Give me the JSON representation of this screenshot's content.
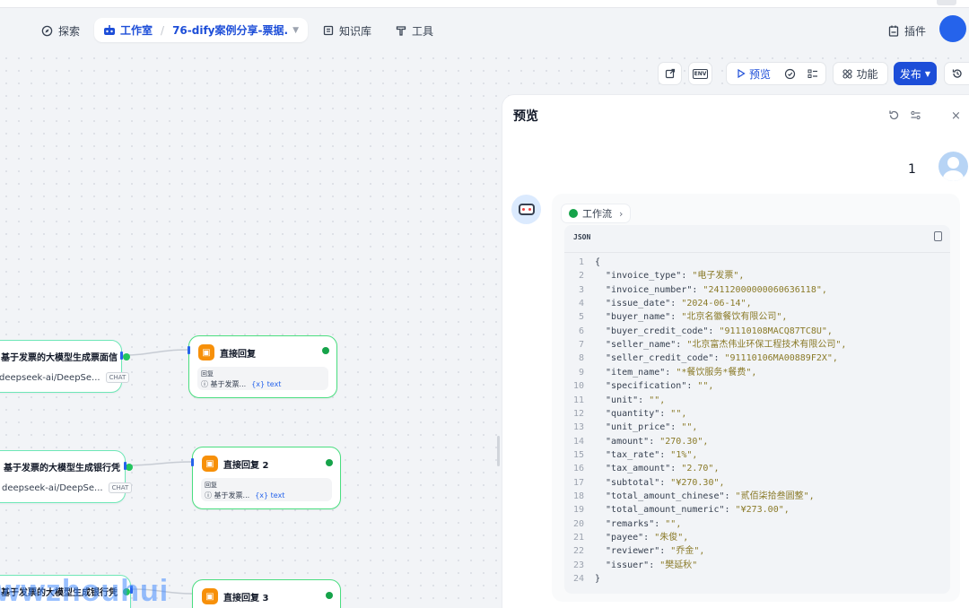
{
  "nav": {
    "explore": "探索",
    "studio": "工作室",
    "app_name": "76-dify案例分享-票据...",
    "knowledge": "知识库",
    "tools": "工具",
    "plugins": "插件"
  },
  "toolbar": {
    "env_label": "ENV",
    "preview": "预览",
    "features": "功能",
    "publish": "发布"
  },
  "nodes": {
    "llm1": {
      "title": "基于发票的大模型生成票面信",
      "model": "deepseek-ai/DeepSe...",
      "tag": "CHAT"
    },
    "llm2": {
      "title": "基于发票的大模型生成银行凭",
      "model": "deepseek-ai/DeepSe...",
      "tag": "CHAT"
    },
    "llm3": {
      "title": "基于发票的大模型生成银行凭"
    },
    "reply1": {
      "title": "直接回复",
      "label": "回复",
      "source": "基于发票...",
      "var": "{x} text"
    },
    "reply2": {
      "title": "直接回复 2",
      "label": "回复",
      "source": "基于发票...",
      "var": "{x} text"
    },
    "reply3": {
      "title": "直接回复 3"
    }
  },
  "preview": {
    "title": "预览",
    "user_message": "1",
    "workflow_chip": "工作流",
    "code_lang": "JSON",
    "code_lines": [
      {
        "n": "1",
        "t": "{"
      },
      {
        "n": "2",
        "k": "\"invoice_type\"",
        "v": "\"电子发票\","
      },
      {
        "n": "3",
        "k": "\"invoice_number\"",
        "v": "\"24112000000060636118\","
      },
      {
        "n": "4",
        "k": "\"issue_date\"",
        "v": "\"2024-06-14\","
      },
      {
        "n": "5",
        "k": "\"buyer_name\"",
        "v": "\"北京名徽餐饮有限公司\","
      },
      {
        "n": "6",
        "k": "\"buyer_credit_code\"",
        "v": "\"91110108MACQ87TC8U\","
      },
      {
        "n": "7",
        "k": "\"seller_name\"",
        "v": "\"北京富杰伟业环保工程技术有限公司\","
      },
      {
        "n": "8",
        "k": "\"seller_credit_code\"",
        "v": "\"91110106MA00889F2X\","
      },
      {
        "n": "9",
        "k": "\"item_name\"",
        "v": "\"*餐饮服务*餐费\","
      },
      {
        "n": "10",
        "k": "\"specification\"",
        "v": "\"\","
      },
      {
        "n": "11",
        "k": "\"unit\"",
        "v": "\"\","
      },
      {
        "n": "12",
        "k": "\"quantity\"",
        "v": "\"\","
      },
      {
        "n": "13",
        "k": "\"unit_price\"",
        "v": "\"\","
      },
      {
        "n": "14",
        "k": "\"amount\"",
        "v": "\"270.30\","
      },
      {
        "n": "15",
        "k": "\"tax_rate\"",
        "v": "\"1%\","
      },
      {
        "n": "16",
        "k": "\"tax_amount\"",
        "v": "\"2.70\","
      },
      {
        "n": "17",
        "k": "\"subtotal\"",
        "v": "\"¥270.30\","
      },
      {
        "n": "18",
        "k": "\"total_amount_chinese\"",
        "v": "\"贰佰柒拾叁圆整\","
      },
      {
        "n": "19",
        "k": "\"total_amount_numeric\"",
        "v": "\"¥273.00\","
      },
      {
        "n": "20",
        "k": "\"remarks\"",
        "v": "\"\","
      },
      {
        "n": "21",
        "k": "\"payee\"",
        "v": "\"朱俊\","
      },
      {
        "n": "22",
        "k": "\"reviewer\"",
        "v": "\"乔金\","
      },
      {
        "n": "23",
        "k": "\"issuer\"",
        "v": "\"樊延秋\""
      },
      {
        "n": "24",
        "t": "}"
      }
    ]
  },
  "watermark": "wwzhouhui",
  "colors": {
    "accent": "#1d4ed8",
    "success": "#16a34a",
    "node_icon": "#f79009"
  }
}
